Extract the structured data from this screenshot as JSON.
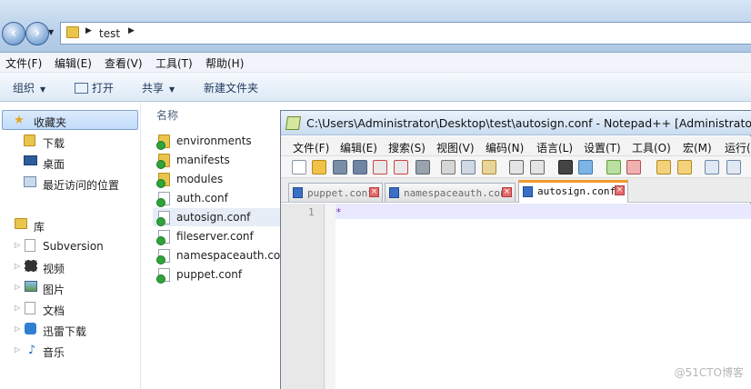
{
  "explorer": {
    "breadcrumb": [
      "test"
    ],
    "menu": [
      "文件(F)",
      "编辑(E)",
      "查看(V)",
      "工具(T)",
      "帮助(H)"
    ],
    "commands": [
      "组织",
      "打开",
      "共享",
      "新建文件夹"
    ],
    "nav": {
      "favorites_label": "收藏夹",
      "favorites": [
        "下载",
        "桌面",
        "最近访问的位置"
      ],
      "libraries_label": "库",
      "libraries": [
        "Subversion",
        "视频",
        "图片",
        "文档",
        "迅雷下载",
        "音乐"
      ]
    },
    "column_name": "名称",
    "files": [
      {
        "name": "environments",
        "kind": "folder"
      },
      {
        "name": "manifests",
        "kind": "folder"
      },
      {
        "name": "modules",
        "kind": "folder"
      },
      {
        "name": "auth.conf",
        "kind": "file"
      },
      {
        "name": "autosign.conf",
        "kind": "file",
        "highlighted": true
      },
      {
        "name": "fileserver.conf",
        "kind": "file"
      },
      {
        "name": "namespaceauth.conf",
        "kind": "file"
      },
      {
        "name": "puppet.conf",
        "kind": "file"
      }
    ]
  },
  "notepad": {
    "title": "C:\\Users\\Administrator\\Desktop\\test\\autosign.conf - Notepad++ [Administrator]",
    "menu": [
      "文件(F)",
      "编辑(E)",
      "搜索(S)",
      "视图(V)",
      "编码(N)",
      "语言(L)",
      "设置(T)",
      "工具(O)",
      "宏(M)",
      "运行("
    ],
    "tabs": [
      {
        "label": "puppet.conf",
        "active": false
      },
      {
        "label": "namespaceauth.conf",
        "active": false
      },
      {
        "label": "autosign.conf",
        "active": true
      }
    ],
    "line_number": "1",
    "line_text": "*"
  },
  "watermark": "@51CTO博客"
}
